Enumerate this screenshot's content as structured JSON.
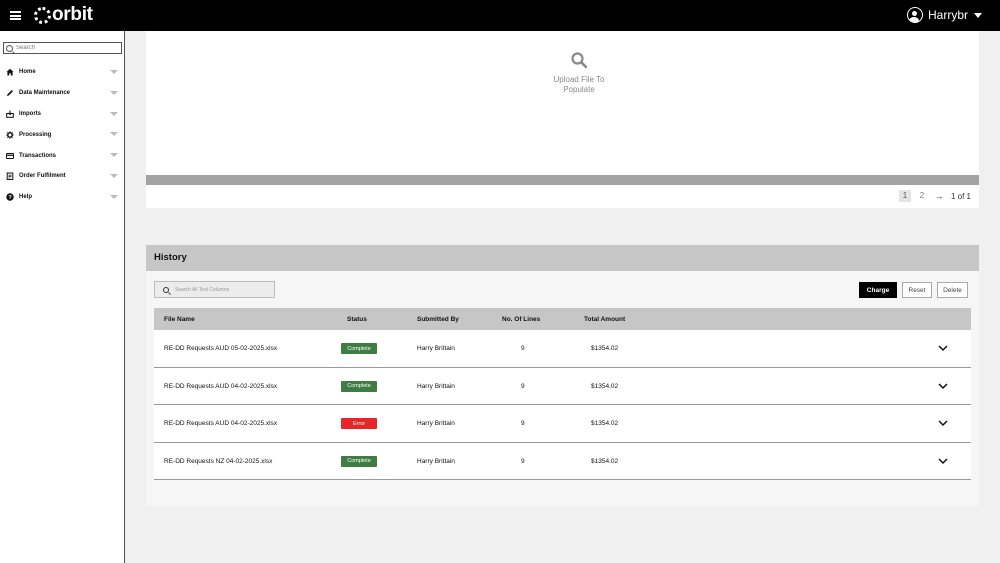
{
  "app": {
    "name": "orbit",
    "user": "Harrybr"
  },
  "sidebar": {
    "search_placeholder": "Search",
    "items": [
      {
        "label": "Home",
        "icon": "home-icon"
      },
      {
        "label": "Data Maintenance",
        "icon": "pencil-icon"
      },
      {
        "label": "Imports",
        "icon": "import-icon"
      },
      {
        "label": "Processing",
        "icon": "gear-icon"
      },
      {
        "label": "Transactions",
        "icon": "card-icon"
      },
      {
        "label": "Order Fulfilment",
        "icon": "clipboard-icon"
      },
      {
        "label": "Help",
        "icon": "help-icon"
      }
    ]
  },
  "upload": {
    "line1": "Upload File To",
    "line2": "Populate",
    "pagination": {
      "pages": [
        "1",
        "2"
      ],
      "arrow": "→",
      "summary": "1 of 1"
    }
  },
  "history": {
    "title": "History",
    "search_placeholder": "Search All Text Columns",
    "buttons": {
      "charge": "Charge",
      "reset": "Reset",
      "delete": "Delete"
    },
    "columns": [
      "File Name",
      "Status",
      "Submitted By",
      "No. Of Lines",
      "Total Amount"
    ],
    "rows": [
      {
        "file": "RE-DD Requests AUD 05-02-2025.xlsx",
        "status": "Complete",
        "status_type": "ok",
        "by": "Harry Brittain",
        "lines": "9",
        "amount": "$1354.02"
      },
      {
        "file": "RE-DD Requests AUD 04-02-2025.xlsx",
        "status": "Complete",
        "status_type": "ok",
        "by": "Harry Brittain",
        "lines": "9",
        "amount": "$1354.02"
      },
      {
        "file": "RE-DD Requests AUD 04-02-2025.xlsx",
        "status": "Error",
        "status_type": "err",
        "by": "Harry Brittain",
        "lines": "9",
        "amount": "$1354.02"
      },
      {
        "file": "RE-DD Requests NZ 04-02-2025.xlsx",
        "status": "Complete",
        "status_type": "ok",
        "by": "Harry Brittain",
        "lines": "9",
        "amount": "$1354.02"
      }
    ]
  },
  "colors": {
    "complete": "#3e7c43",
    "error": "#e8262a",
    "header_bg": "#000000",
    "table_header": "#c6c6c6"
  }
}
